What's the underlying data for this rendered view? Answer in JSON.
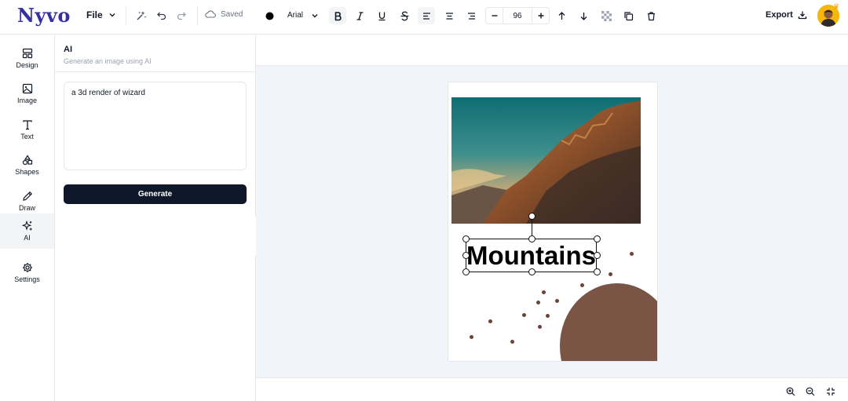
{
  "app": {
    "logo": "Nyvo"
  },
  "topbar": {
    "file_label": "File",
    "saved_label": "Saved",
    "export_label": "Export"
  },
  "rail": {
    "items": [
      {
        "label": "Design",
        "icon": "layout-icon"
      },
      {
        "label": "Image",
        "icon": "image-icon"
      },
      {
        "label": "Text",
        "icon": "text-icon"
      },
      {
        "label": "Shapes",
        "icon": "shapes-icon"
      },
      {
        "label": "Draw",
        "icon": "pencil-icon"
      },
      {
        "label": "AI",
        "icon": "sparkles-icon",
        "active": true
      },
      {
        "label": "Settings",
        "icon": "gear-icon"
      }
    ]
  },
  "panel": {
    "title": "AI",
    "subtitle": "Generate an image using AI",
    "prompt_value": "a 3d render of wizard",
    "generate_label": "Generate",
    "collapse_glyph": "«"
  },
  "format": {
    "font_family": "Arial",
    "font_size": "96"
  },
  "canvas": {
    "text": "Mountains"
  },
  "colors": {
    "accent": "#3730a3",
    "button": "#0f172a",
    "shape": "#7a5445",
    "dots": "#6b4437",
    "canvas_bg": "#f1f4f9"
  }
}
